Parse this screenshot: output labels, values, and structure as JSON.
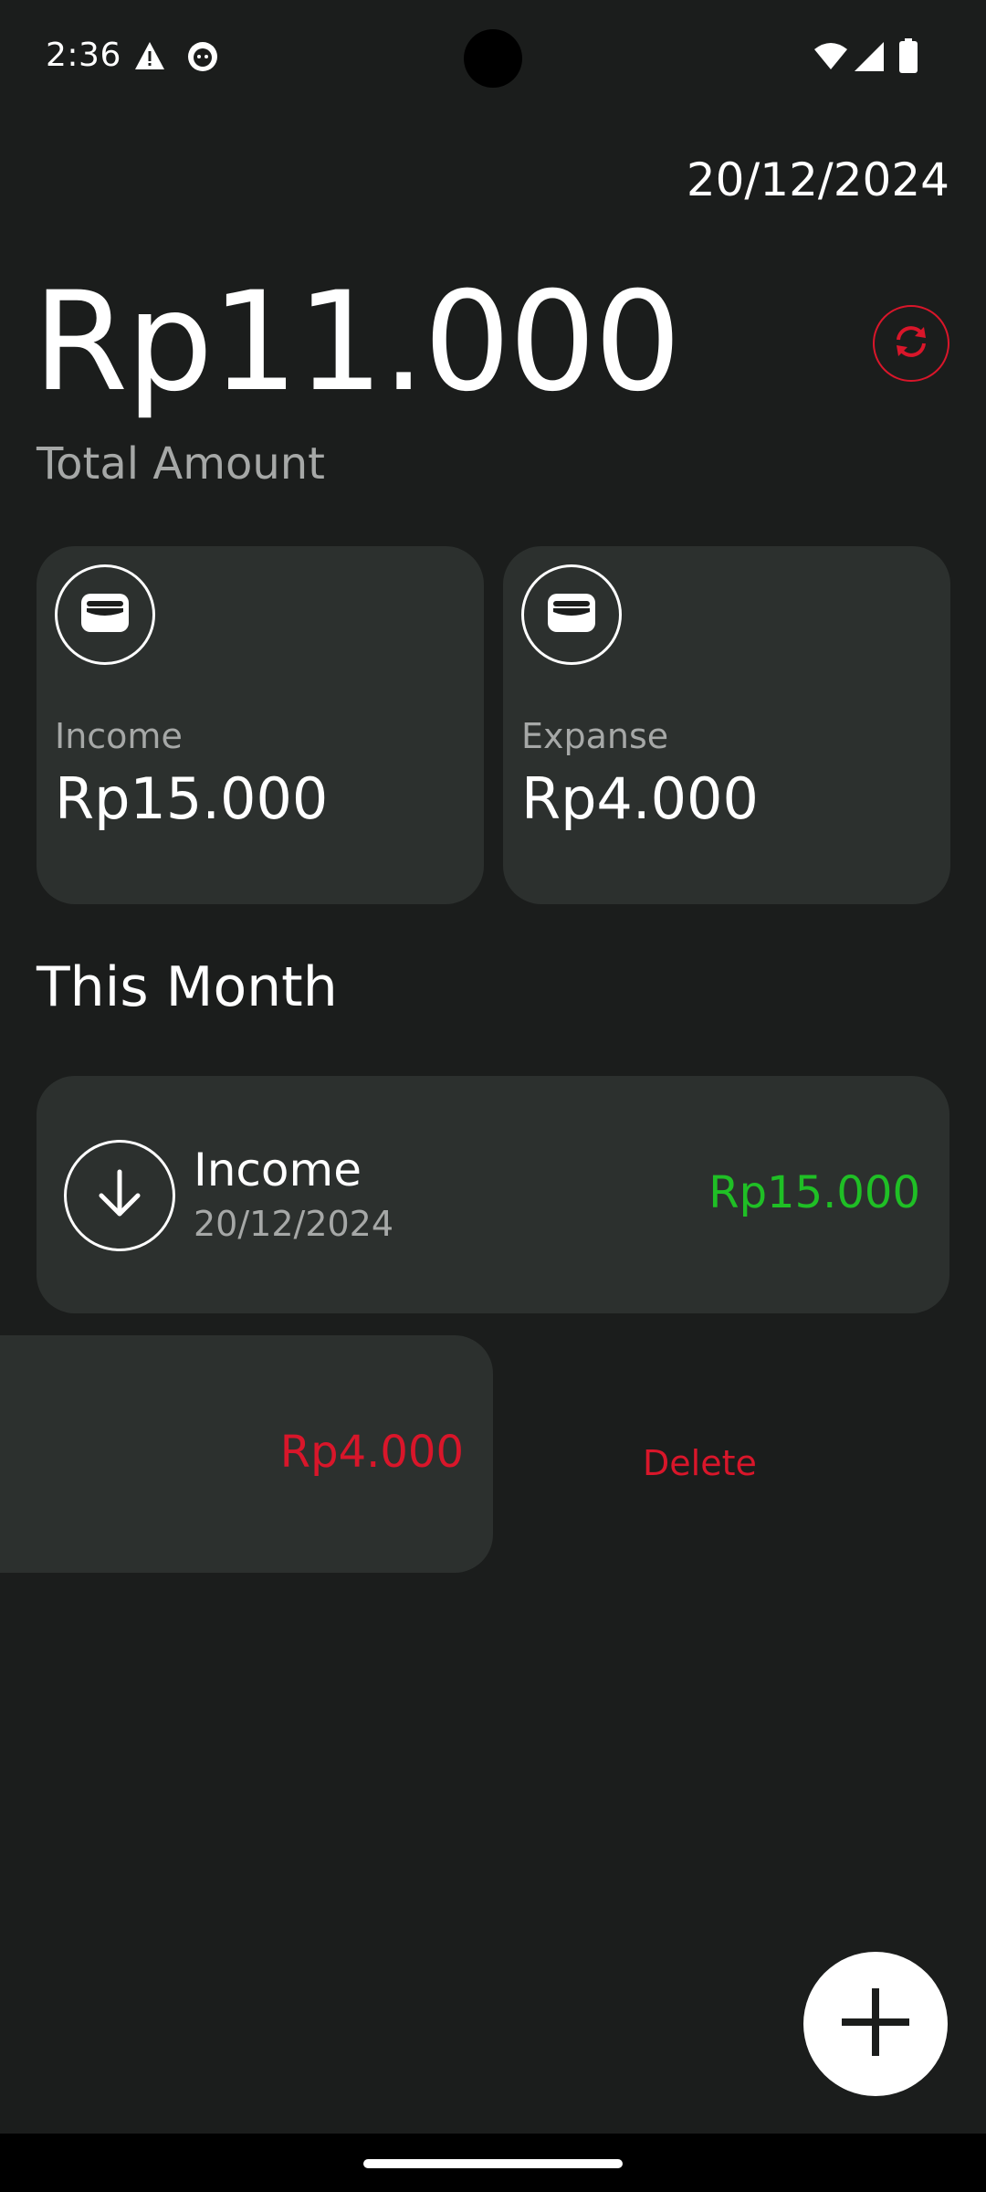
{
  "status_bar": {
    "time": "2:36",
    "icons": [
      "warning-icon",
      "cat-face-icon",
      "wifi-icon",
      "signal-icon",
      "battery-icon"
    ]
  },
  "header": {
    "date": "20/12/2024"
  },
  "balance": {
    "total_amount": "Rp11.000",
    "total_label": "Total Amount",
    "refresh_icon": "refresh-icon"
  },
  "summary": {
    "income": {
      "label": "Income",
      "value": "Rp15.000",
      "icon": "wallet-icon"
    },
    "expense": {
      "label": "Expanse",
      "value": "Rp4.000",
      "icon": "wallet-icon"
    }
  },
  "section": {
    "title": "This Month"
  },
  "transactions": [
    {
      "type": "income",
      "title": "Income",
      "date": "20/12/2024",
      "amount": "Rp15.000",
      "icon": "arrow-down-icon"
    },
    {
      "type": "expense",
      "amount": "Rp4.000"
    }
  ],
  "swipe_action": {
    "delete_label": "Delete"
  },
  "fab": {
    "icon": "plus-icon"
  },
  "colors": {
    "background": "#1b1d1c",
    "card": "#2c302e",
    "income": "#1fbf25",
    "expense": "#d9162a",
    "muted_text": "#a6a8a7"
  }
}
